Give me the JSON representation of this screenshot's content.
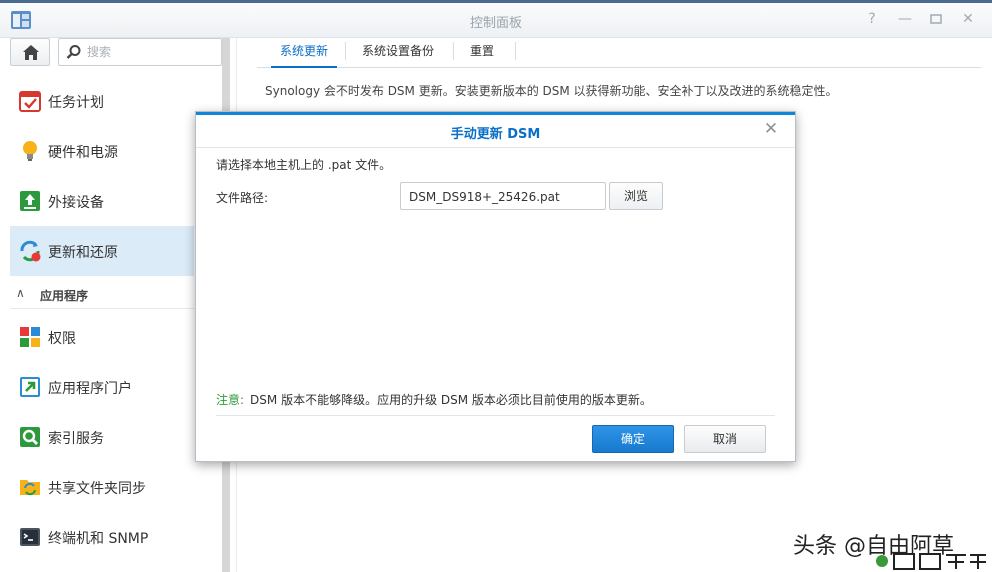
{
  "window": {
    "title": "控制面板",
    "buttons": [
      "help-icon",
      "minimize-icon",
      "maximize-icon",
      "close-icon"
    ]
  },
  "sidebar": {
    "search_placeholder": "搜索",
    "items": [
      {
        "label": "任务计划",
        "icon": "task-scheduler-icon"
      },
      {
        "label": "硬件和电源",
        "icon": "lightbulb-icon"
      },
      {
        "label": "外接设备",
        "icon": "external-device-icon"
      },
      {
        "label": "更新和还原",
        "icon": "update-restore-icon",
        "active": true
      }
    ],
    "section": {
      "label": "应用程序",
      "icon": "chevron-up-icon"
    },
    "app_items": [
      {
        "label": "权限",
        "icon": "privileges-icon"
      },
      {
        "label": "应用程序门户",
        "icon": "app-portal-icon"
      },
      {
        "label": "索引服务",
        "icon": "indexing-icon"
      },
      {
        "label": "共享文件夹同步",
        "icon": "folder-sync-icon"
      },
      {
        "label": "终端机和 SNMP",
        "icon": "terminal-icon"
      }
    ]
  },
  "main": {
    "tabs": [
      {
        "label": "系统更新",
        "active": true
      },
      {
        "label": "系统设置备份"
      },
      {
        "label": "重置"
      }
    ],
    "description": "Synology 会不时发布 DSM 更新。安装更新版本的 DSM 以获得新功能、安全补丁以及改进的系统稳定性。"
  },
  "dialog": {
    "title": "手动更新 DSM",
    "instruction": "请选择本地主机上的 .pat 文件。",
    "path_label": "文件路径:",
    "path_value": "DSM_DS918+_25426.pat",
    "browse_label": "浏览",
    "note_key": "注意:",
    "note_text": "DSM 版本不能够降级。应用的升级 DSM 版本必须比目前使用的版本更新。",
    "ok_label": "确定",
    "cancel_label": "取消"
  },
  "watermark": {
    "text": "头条 @自由阿草",
    "stamp": "自由阿草"
  },
  "colors": {
    "accent": "#0b6ec7",
    "primary_button": "#1f86dc",
    "active_nav_bg": "#dcebf8",
    "note_key": "#2f9a3a"
  }
}
